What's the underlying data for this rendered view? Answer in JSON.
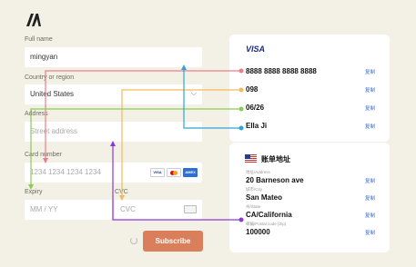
{
  "form": {
    "full_name_label": "Full name",
    "full_name_value": "mingyan",
    "country_label": "Country or region",
    "country_value": "United States",
    "address_label": "Address",
    "address_placeholder": "Street address",
    "card_label": "Card number",
    "card_placeholder": "1234 1234 1234 1234",
    "card_brands": [
      "VISA",
      "Mastercard",
      "AMEX"
    ],
    "expiry_label": "Expiry",
    "expiry_placeholder": "MM / YY",
    "cvc_label": "CVC",
    "cvc_placeholder": "CVC",
    "subscribe_label": "Subscribe"
  },
  "card_panel": {
    "brand": "VISA",
    "card_number": "8888 8888 8888 8888",
    "expiry_code": "098",
    "date": "06/26",
    "name": "Ella Ji",
    "copy_label": "复制"
  },
  "billing_panel": {
    "title": "账单地址",
    "address_label": "地址/Address",
    "address": "20 Barneson ave",
    "city_label": "城市/City",
    "city": "San Mateo",
    "state_label": "州/State",
    "state": "CA/California",
    "postal_label": "邮编/Postal code (Zip)",
    "postal": "100000",
    "copy_label": "复制"
  },
  "colors": {
    "accent": "#da7f5c",
    "pink": "#ee7d8a",
    "orange": "#f3ba5a",
    "green": "#8ccc55",
    "blue": "#2fa4d8",
    "purple": "#8a3ad6"
  }
}
